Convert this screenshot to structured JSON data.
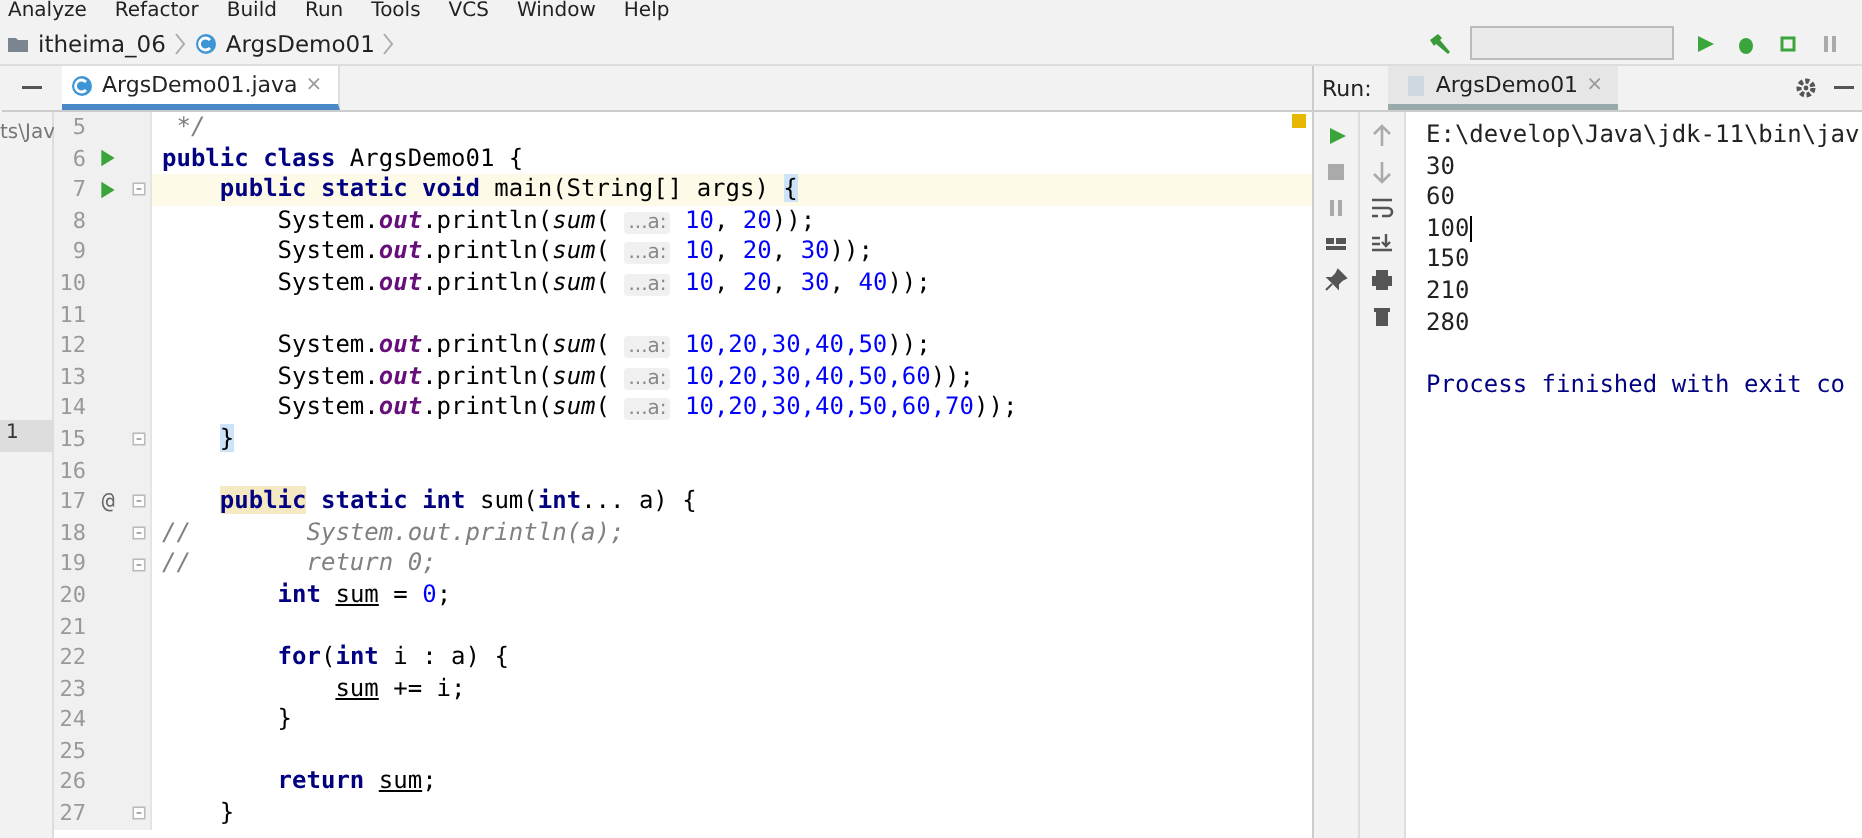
{
  "menu": [
    "Analyze",
    "Refactor",
    "Build",
    "Run",
    "Tools",
    "VCS",
    "Window",
    "Help"
  ],
  "breadcrumb": [
    {
      "label": "itheima_06",
      "kind": "folder"
    },
    {
      "label": "ArgsDemo01",
      "kind": "class"
    }
  ],
  "project_strip": {
    "path": "ts\\Jav",
    "line": "1"
  },
  "editor_tab": {
    "label": "ArgsDemo01.java",
    "close": "×",
    "selected": true
  },
  "code": [
    {
      "number": "5",
      "segments": [
        {
          "t": " */",
          "kind": "comment"
        }
      ]
    },
    {
      "number": "6",
      "run": true,
      "segments": [
        {
          "t": "public class",
          "kind": "kw"
        },
        {
          "t": " ArgsDemo01 {",
          "kind": "plain"
        }
      ]
    },
    {
      "number": "7",
      "run": true,
      "fold": true,
      "current": true,
      "segments": [
        {
          "t": "    public static void",
          "kind": "kw"
        },
        {
          "t": " main(String[] args) ",
          "kind": "plain"
        },
        {
          "t": "{",
          "kind": "brace"
        }
      ]
    },
    {
      "number": "8",
      "segments": [
        {
          "t": "        System.",
          "kind": "plain"
        },
        {
          "t": "out",
          "kind": "field"
        },
        {
          "t": ".println(",
          "kind": "plain"
        },
        {
          "t": "sum",
          "kind": "method"
        },
        {
          "t": "( ",
          "kind": "plain"
        },
        {
          "t": "...a:",
          "kind": "hint"
        },
        {
          "t": " 10",
          "kind": "num"
        },
        {
          "t": ", ",
          "kind": "plain"
        },
        {
          "t": "20",
          "kind": "num"
        },
        {
          "t": "));",
          "kind": "plain"
        }
      ]
    },
    {
      "number": "9",
      "segments": [
        {
          "t": "        System.",
          "kind": "plain"
        },
        {
          "t": "out",
          "kind": "field"
        },
        {
          "t": ".println(",
          "kind": "plain"
        },
        {
          "t": "sum",
          "kind": "method"
        },
        {
          "t": "( ",
          "kind": "plain"
        },
        {
          "t": "...a:",
          "kind": "hint"
        },
        {
          "t": " 10",
          "kind": "num"
        },
        {
          "t": ", ",
          "kind": "plain"
        },
        {
          "t": "20",
          "kind": "num"
        },
        {
          "t": ", ",
          "kind": "plain"
        },
        {
          "t": "30",
          "kind": "num"
        },
        {
          "t": "));",
          "kind": "plain"
        }
      ]
    },
    {
      "number": "10",
      "segments": [
        {
          "t": "        System.",
          "kind": "plain"
        },
        {
          "t": "out",
          "kind": "field"
        },
        {
          "t": ".println(",
          "kind": "plain"
        },
        {
          "t": "sum",
          "kind": "method"
        },
        {
          "t": "( ",
          "kind": "plain"
        },
        {
          "t": "...a:",
          "kind": "hint"
        },
        {
          "t": " 10",
          "kind": "num"
        },
        {
          "t": ", ",
          "kind": "plain"
        },
        {
          "t": "20",
          "kind": "num"
        },
        {
          "t": ", ",
          "kind": "plain"
        },
        {
          "t": "30",
          "kind": "num"
        },
        {
          "t": ", ",
          "kind": "plain"
        },
        {
          "t": "40",
          "kind": "num"
        },
        {
          "t": "));",
          "kind": "plain"
        }
      ]
    },
    {
      "number": "11"
    },
    {
      "number": "12",
      "segments": [
        {
          "t": "        System.",
          "kind": "plain"
        },
        {
          "t": "out",
          "kind": "field"
        },
        {
          "t": ".println(",
          "kind": "plain"
        },
        {
          "t": "sum",
          "kind": "method"
        },
        {
          "t": "( ",
          "kind": "plain"
        },
        {
          "t": "...a:",
          "kind": "hint"
        },
        {
          "t": " 10,20,30,40,50",
          "kind": "num"
        },
        {
          "t": "));",
          "kind": "plain"
        }
      ]
    },
    {
      "number": "13",
      "segments": [
        {
          "t": "        System.",
          "kind": "plain"
        },
        {
          "t": "out",
          "kind": "field"
        },
        {
          "t": ".println(",
          "kind": "plain"
        },
        {
          "t": "sum",
          "kind": "method"
        },
        {
          "t": "( ",
          "kind": "plain"
        },
        {
          "t": "...a:",
          "kind": "hint"
        },
        {
          "t": " 10,20,30,40,50,60",
          "kind": "num"
        },
        {
          "t": "));",
          "kind": "plain"
        }
      ]
    },
    {
      "number": "14",
      "segments": [
        {
          "t": "        System.",
          "kind": "plain"
        },
        {
          "t": "out",
          "kind": "field"
        },
        {
          "t": ".println(",
          "kind": "plain"
        },
        {
          "t": "sum",
          "kind": "method"
        },
        {
          "t": "( ",
          "kind": "plain"
        },
        {
          "t": "...a:",
          "kind": "hint"
        },
        {
          "t": " 10,20,30,40,50,60,70",
          "kind": "num"
        },
        {
          "t": "));",
          "kind": "plain"
        }
      ]
    },
    {
      "number": "15",
      "fold": true,
      "segments": [
        {
          "t": "    }",
          "kind": "brace"
        }
      ]
    },
    {
      "number": "16"
    },
    {
      "number": "17",
      "marker": "@",
      "fold": true,
      "segments": [
        {
          "t": "    public",
          "kind": "kw-mark"
        },
        {
          "t": " static int",
          "kind": "kw"
        },
        {
          "t": " sum(",
          "kind": "plain"
        },
        {
          "t": "int",
          "kind": "kw"
        },
        {
          "t": "... a) {",
          "kind": "plain"
        }
      ]
    },
    {
      "number": "18",
      "fold": true,
      "segments": [
        {
          "t": "//        System.out.println(a);",
          "kind": "comment"
        }
      ]
    },
    {
      "number": "19",
      "fold": true,
      "segments": [
        {
          "t": "//        return 0;",
          "kind": "comment"
        }
      ]
    },
    {
      "number": "20",
      "segments": [
        {
          "t": "        int",
          "kind": "kw"
        },
        {
          "t": " sum",
          "kind": "var"
        },
        {
          "t": " = ",
          "kind": "plain"
        },
        {
          "t": "0",
          "kind": "num"
        },
        {
          "t": ";",
          "kind": "plain"
        }
      ]
    },
    {
      "number": "21"
    },
    {
      "number": "22",
      "segments": [
        {
          "t": "        for",
          "kind": "kw"
        },
        {
          "t": "(",
          "kind": "plain"
        },
        {
          "t": "int",
          "kind": "kw"
        },
        {
          "t": " i : a) {",
          "kind": "plain"
        }
      ]
    },
    {
      "number": "23",
      "segments": [
        {
          "t": "            sum",
          "kind": "var"
        },
        {
          "t": " += i;",
          "kind": "plain"
        }
      ]
    },
    {
      "number": "24",
      "segments": [
        {
          "t": "        }",
          "kind": "plain"
        }
      ]
    },
    {
      "number": "25"
    },
    {
      "number": "26",
      "segments": [
        {
          "t": "        return",
          "kind": "kw"
        },
        {
          "t": " sum",
          "kind": "var"
        },
        {
          "t": ";",
          "kind": "plain"
        }
      ]
    },
    {
      "number": "27",
      "fold": true,
      "segments": [
        {
          "t": "    }",
          "kind": "plain"
        }
      ]
    }
  ],
  "run_panel": {
    "label": "Run:",
    "tab": {
      "label": "ArgsDemo01",
      "close": "×",
      "selected": true
    },
    "console": [
      {
        "text": "E:\\develop\\Java\\jdk-11\\bin\\jav",
        "kind": "command"
      },
      {
        "text": "30",
        "kind": "output"
      },
      {
        "text": "60",
        "kind": "output"
      },
      {
        "text": "100",
        "kind": "output",
        "caret": true
      },
      {
        "text": "150",
        "kind": "output"
      },
      {
        "text": "210",
        "kind": "output"
      },
      {
        "text": "280",
        "kind": "output"
      },
      {
        "kind": "blank"
      },
      {
        "text": "Process finished with exit co",
        "kind": "system"
      }
    ]
  }
}
